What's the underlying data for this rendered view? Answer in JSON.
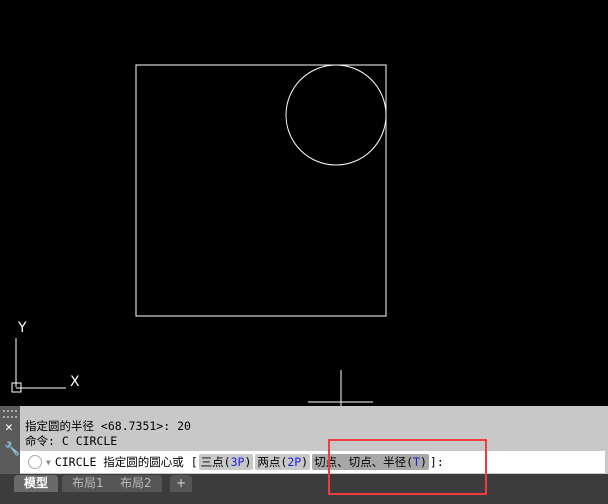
{
  "history": [
    "指定圆的半径 <68.7351>: 20",
    "命令: C CIRCLE"
  ],
  "prompt": {
    "command": "CIRCLE 指定圆的圆心或 [",
    "opt1": "三点(",
    "opt1_key": "3P",
    "opt2": "两点(",
    "opt2_key": "2P",
    "opt3": "切点、切点、半径(",
    "opt3_key": "T",
    "close": ")",
    "end": "]:"
  },
  "axis": {
    "x": "X",
    "y": "Y"
  },
  "tabs": [
    "模型",
    "布局1",
    "布局2",
    "+"
  ],
  "colors": {
    "highlight": "#f03c3c",
    "keyword": "#2020e0"
  }
}
